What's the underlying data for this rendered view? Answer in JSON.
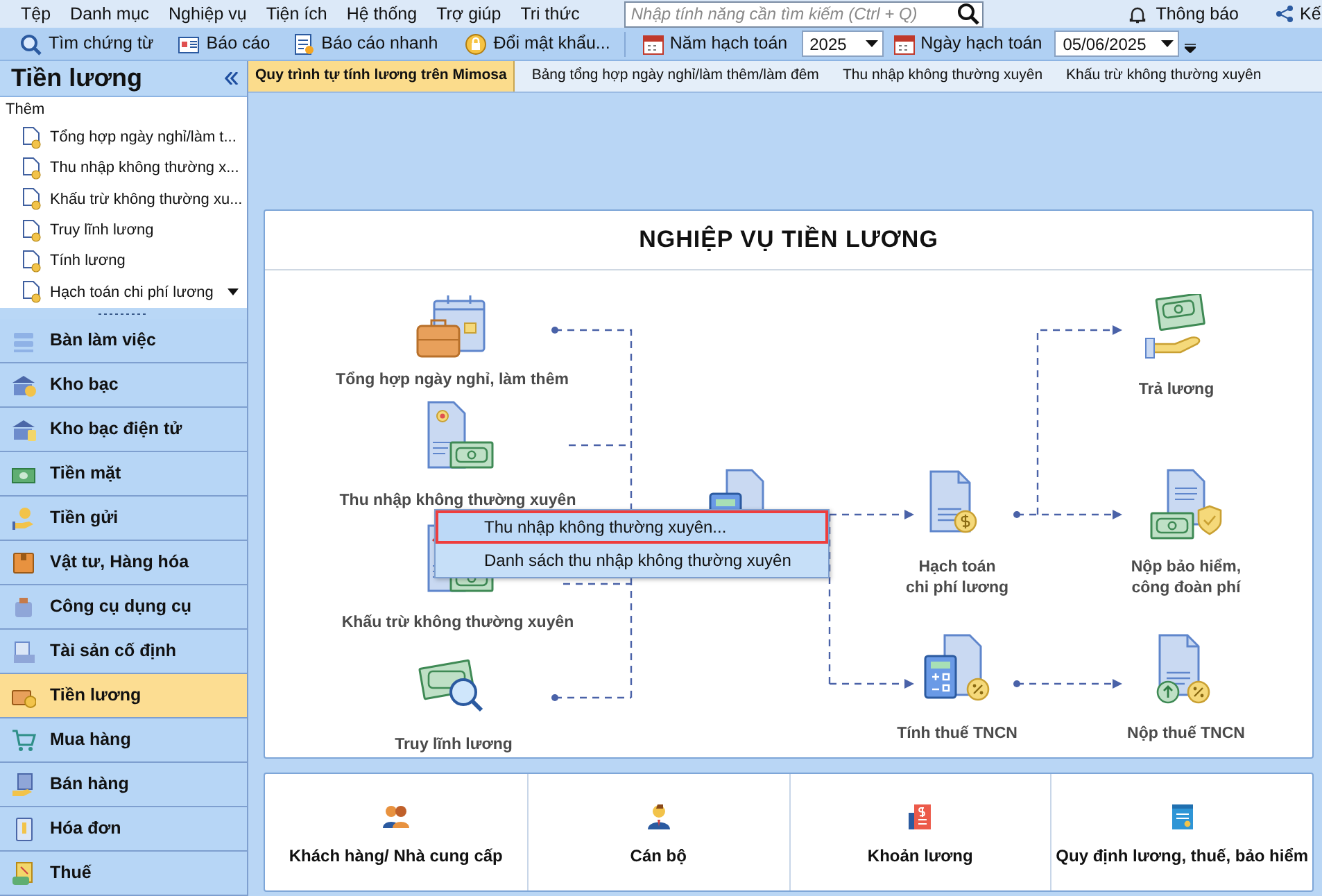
{
  "menu_bar": {
    "items": [
      "Tệp",
      "Danh mục",
      "Nghiệp vụ",
      "Tiện ích",
      "Hệ thống",
      "Trợ giúp",
      "Tri thức"
    ],
    "search": {
      "placeholder": "Nhập tính năng cần tìm kiếm (Ctrl + Q)"
    },
    "notifications": "Thông báo",
    "cut_item": "Kế"
  },
  "toolbar": {
    "buttons": [
      "Tìm chứng từ",
      "Báo cáo",
      "Báo cáo nhanh",
      "Đổi mật khẩu..."
    ],
    "year": {
      "label": "Năm hạch toán",
      "value": "2025"
    },
    "date": {
      "label": "Ngày hạch toán",
      "value": "05/06/2025"
    }
  },
  "sidebar": {
    "title": "Tiền lương",
    "add_label": "Thêm",
    "items": [
      "Tổng hợp ngày nghỉ/làm t...",
      "Thu nhập không thường x...",
      "Khấu trừ không thường xu...",
      "Truy lĩnh lương",
      "Tính lương",
      "Hạch toán chi phí lương"
    ],
    "nav": [
      {
        "label": "Bàn làm việc",
        "selected": false
      },
      {
        "label": "Kho bạc",
        "selected": false
      },
      {
        "label": "Kho bạc điện tử",
        "selected": false
      },
      {
        "label": "Tiền mặt",
        "selected": false
      },
      {
        "label": "Tiền gửi",
        "selected": false
      },
      {
        "label": "Vật tư, Hàng hóa",
        "selected": false
      },
      {
        "label": "Công cụ dụng cụ",
        "selected": false
      },
      {
        "label": "Tài sản cố định",
        "selected": false
      },
      {
        "label": "Tiền lương",
        "selected": true
      },
      {
        "label": "Mua hàng",
        "selected": false
      },
      {
        "label": "Bán hàng",
        "selected": false
      },
      {
        "label": "Hóa đơn",
        "selected": false
      },
      {
        "label": "Thuế",
        "selected": false
      }
    ]
  },
  "tabs": [
    {
      "label": "Quy trình tự tính lương trên Mimosa",
      "selected": true
    },
    {
      "label": "Bảng tổng hợp ngày nghỉ/làm thêm/làm đêm",
      "selected": false
    },
    {
      "label": "Thu nhập không thường xuyên",
      "selected": false
    },
    {
      "label": "Khấu trừ không thường xuyên",
      "selected": false
    }
  ],
  "diagram": {
    "title": "NGHIỆP VỤ TIỀN LƯƠNG",
    "nodes": [
      {
        "label": "Tổng hợp ngày nghỉ, làm thêm"
      },
      {
        "label": "Thu nhập không thường xuyên"
      },
      {
        "label": "Khấu trừ không thường xuyên"
      },
      {
        "label": "Truy lĩnh lương"
      },
      {
        "label": "Hạch toán\nchi phí lương"
      },
      {
        "label": "Tính thuế TNCN"
      },
      {
        "label": "Trả lương"
      },
      {
        "label": "Nộp bảo hiểm,\ncông đoàn phí"
      },
      {
        "label": "Nộp thuế TNCN"
      }
    ],
    "context_menu": {
      "items": [
        {
          "label": "Thu nhập không thường xuyên...",
          "selected": true
        },
        {
          "label": "Danh sách thu nhập không thường xuyên",
          "selected": false
        }
      ]
    }
  },
  "shortcuts": [
    "Khách hàng/ Nhà cung cấp",
    "Cán bộ",
    "Khoản lương",
    "Quy định lương, thuế, bảo hiểm"
  ]
}
